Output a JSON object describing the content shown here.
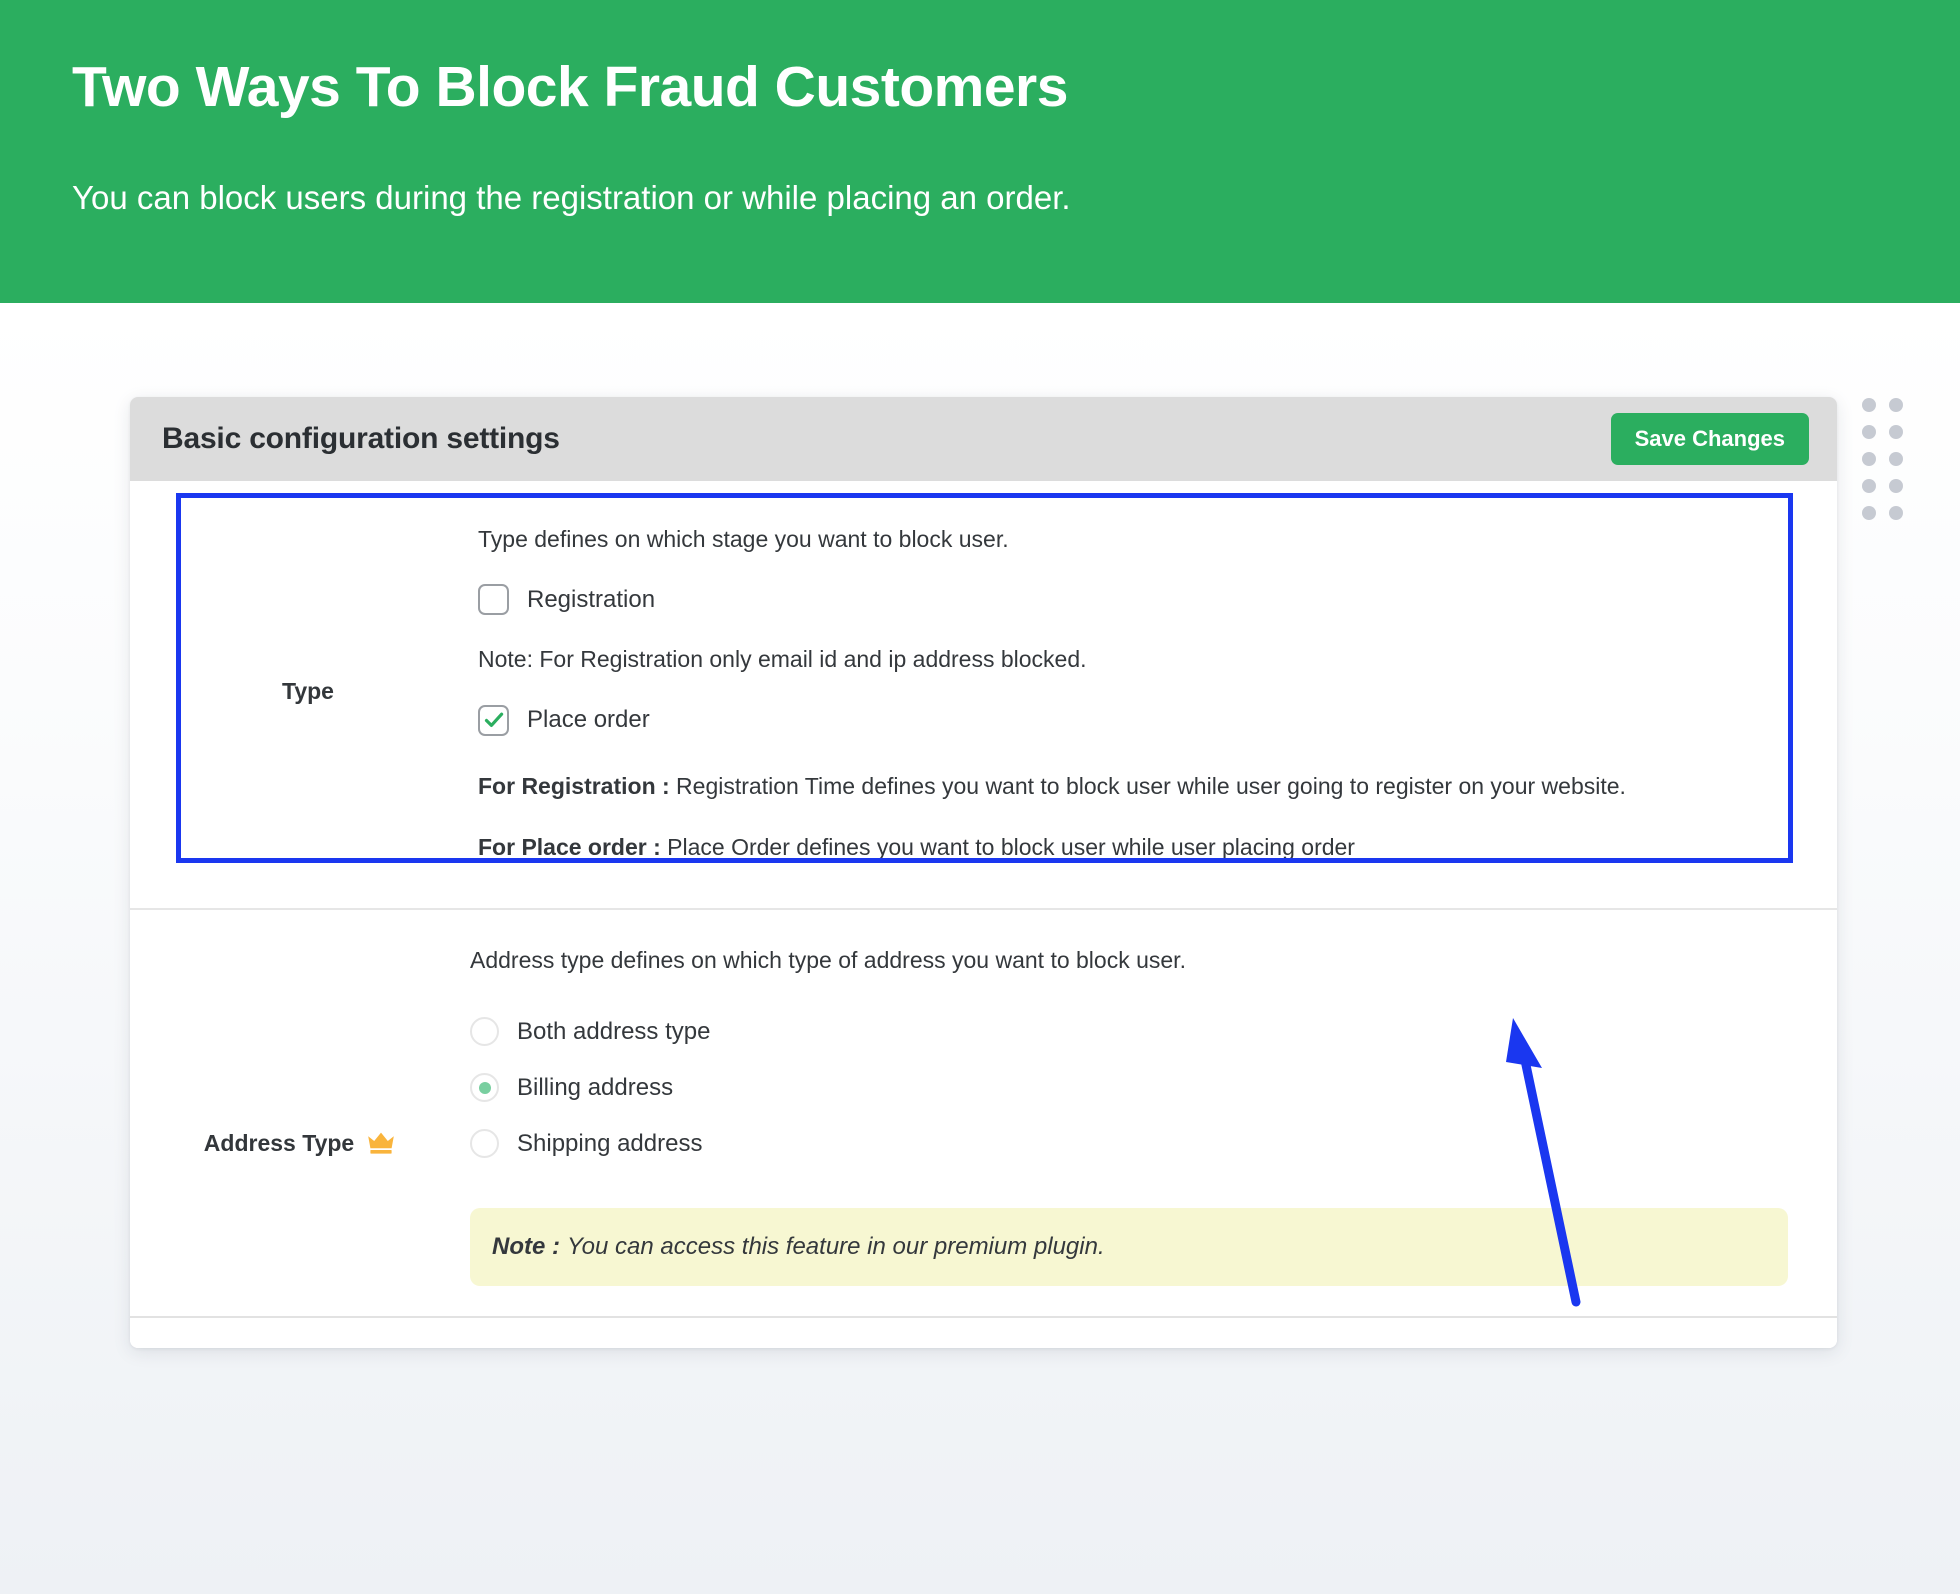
{
  "hero": {
    "title": "Two Ways To Block Fraud Customers",
    "subtitle": "You can block users during the registration or while placing an order.",
    "bg_color": "#2BAE5F"
  },
  "card": {
    "header": {
      "title": "Basic configuration settings",
      "save_label": "Save Changes",
      "save_color": "#2BAE5F"
    },
    "rows": {
      "type": {
        "label": "Type",
        "description": "Type defines on which stage you want to block user.",
        "options": [
          {
            "label": "Registration",
            "checked": false
          },
          {
            "label": "Place order",
            "checked": true
          }
        ],
        "note": "Note: For Registration only email id and ip address blocked.",
        "help_registration_strong": "For Registration :",
        "help_registration_text": " Registration Time defines you want to block user while user going to register on your website.",
        "help_placeorder_strong": "For Place order :",
        "help_placeorder_text": " Place Order defines you want to block user while user placing order",
        "highlight_color": "#1A37F0"
      },
      "address_type": {
        "label": "Address Type",
        "badge_icon": "crown-icon",
        "badge_color": "#F9B43C",
        "description": "Address type defines on which type of address you want to block user.",
        "options": [
          {
            "label": "Both address type",
            "selected": false
          },
          {
            "label": "Billing address",
            "selected": true
          },
          {
            "label": "Shipping address",
            "selected": false
          }
        ],
        "premium_note_strong": "Note :",
        "premium_note_text": " You can access this feature in our premium plugin.",
        "premium_note_bg": "#F7F7D2"
      }
    }
  },
  "decor": {
    "dot_grid_rows": 5,
    "dot_grid_cols": 2,
    "dot_color": "#C6CAD2",
    "arrow_color": "#1A37F0",
    "arrow_name": "annotation-arrow"
  }
}
